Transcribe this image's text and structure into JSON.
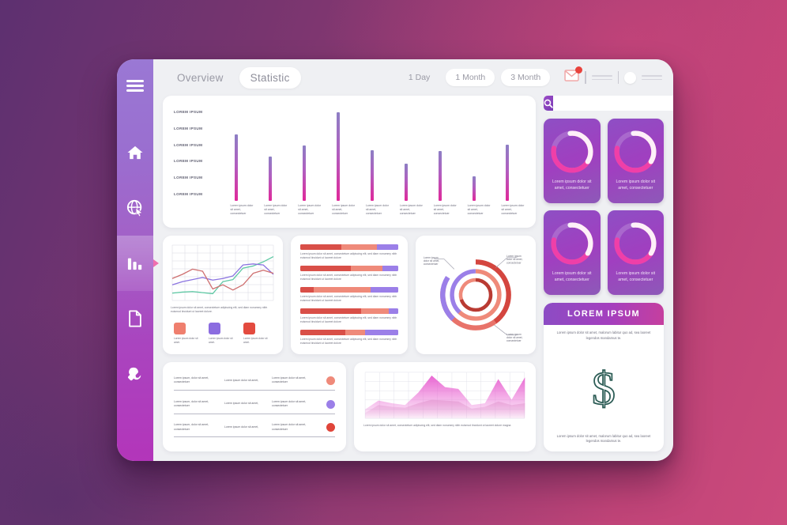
{
  "theme": {
    "bg_gradient_from": "#5d3070",
    "bg_gradient_to": "#cc4a7c",
    "sidebar_from": "#9a78d4",
    "sidebar_to": "#b335ba",
    "bar_top": "#8d7fc4",
    "bar_bottom": "#e0289a",
    "accent_red": "#d94f48",
    "accent_salmon": "#ef8a7a",
    "accent_purple": "#9b7fe8",
    "badge_red": "#e8423c",
    "dollar_teal": "#2d5d56"
  },
  "sidebar": {
    "menu_icon": "hamburger-icon",
    "items": [
      {
        "name": "home",
        "icon": "home-icon",
        "active": false
      },
      {
        "name": "globe",
        "icon": "globe-cursor-icon",
        "active": false
      },
      {
        "name": "statistics",
        "icon": "bar-chart-icon",
        "active": true
      },
      {
        "name": "documents",
        "icon": "document-icon",
        "active": false
      },
      {
        "name": "settings",
        "icon": "wrench-icon",
        "active": false
      }
    ]
  },
  "topbar": {
    "tabs": [
      {
        "label": "Overview",
        "active": false
      },
      {
        "label": "Statistic",
        "active": true
      }
    ],
    "ranges": [
      {
        "label": "1 Day",
        "boxed": false
      },
      {
        "label": "1 Month",
        "boxed": true
      },
      {
        "label": "3 Month",
        "boxed": true
      }
    ],
    "mail_icon": "mail-icon",
    "avatar_icon": "avatar-icon"
  },
  "search": {
    "icon": "search-icon",
    "value": "",
    "placeholder": ""
  },
  "chart_data": [
    {
      "id": "main-bar-chart",
      "type": "bar",
      "title": "",
      "xlabel": "",
      "ylabel": "",
      "y_tick_labels": [
        "LOREM IPSUM",
        "LOREM IPSUM",
        "LOREM IPSUM",
        "LOREM IPSUM",
        "LOREM IPSUM",
        "LOREM IPSUM"
      ],
      "categories": [
        "Lorem ipsum dolor sit amet, consectetuer",
        "Lorem ipsum dolor sit amet, consectetuer",
        "Lorem ipsum dolor sit amet, consectetuer",
        "Lorem ipsum dolor sit amet, consectetuer",
        "Lorem ipsum dolor sit amet, consectetuer",
        "Lorem ipsum dolor sit amet, consectetuer",
        "Lorem ipsum dolor sit amet, consectetuer",
        "Lorem ipsum dolor sit amet, consectetuer",
        "Lorem ipsum dolor sit amet, consectetuer"
      ],
      "values": [
        75,
        50,
        63,
        100,
        57,
        42,
        56,
        28,
        64
      ],
      "ylim": [
        0,
        100
      ],
      "grid": false
    },
    {
      "id": "multi-line-chart",
      "type": "line",
      "grid": true,
      "x": [
        0,
        1,
        2,
        3,
        4,
        5,
        6,
        7,
        8,
        9,
        10
      ],
      "series": [
        {
          "name": "Lorem ipsum dolor sit amet.",
          "color": "#5fc9a4",
          "values": [
            14,
            16,
            17,
            15,
            13,
            36,
            40,
            62,
            66,
            74,
            84
          ]
        },
        {
          "name": "Lorem ipsum dolor sit amet.",
          "color": "#8b74e0",
          "values": [
            30,
            36,
            40,
            44,
            39,
            42,
            47,
            68,
            70,
            68,
            50
          ]
        },
        {
          "name": "Lorem ipsum dolor sit amet.",
          "color": "#cf7070",
          "values": [
            42,
            50,
            60,
            56,
            22,
            30,
            20,
            30,
            52,
            58,
            52
          ]
        }
      ],
      "caption": "Lorem ipsum dolor sit amet, consectetuer adipiscing elit, sed diam nonummy nibh euismod tincidunt ut laoreet dolore.",
      "legend": [
        {
          "color": "#ef7f6e",
          "label": "Lorem ipsum dolor sit amet."
        },
        {
          "color": "#8b6ce0",
          "label": "Lorem ipsum dolor sit amet."
        },
        {
          "color": "#e34b3f",
          "label": "Lorem ipsum dolor sit amet."
        }
      ]
    },
    {
      "id": "stacked-hbar-list",
      "type": "bar",
      "orientation": "horizontal",
      "series_names": [
        "segment-1",
        "segment-2",
        "segment-3"
      ],
      "rows": [
        {
          "s1": 42,
          "s2": 36,
          "s3": 22,
          "caption": "Lorem ipsum dolor sit amet, consectetuer adipiscing elit, sed diam nonummy nibh euismod tincidunt ut laoreet dolore"
        },
        {
          "s1": 52,
          "s2": 32,
          "s3": 16,
          "caption": "Lorem ipsum dolor sit amet, consectetuer adipiscing elit, sed diam nonummy nibh euismod tincidunt ut laoreet dolore"
        },
        {
          "s1": 14,
          "s2": 58,
          "s3": 28,
          "caption": "Lorem ipsum dolor sit amet, consectetuer adipiscing elit, sed diam nonummy nibh euismod tincidunt ut laoreet dolore"
        },
        {
          "s1": 62,
          "s2": 28,
          "s3": 10,
          "caption": "Lorem ipsum dolor sit amet, consectetuer adipiscing elit, sed diam nonummy nibh euismod tincidunt ut laoreet dolore"
        },
        {
          "s1": 46,
          "s2": 20,
          "s3": 34,
          "caption": "Lorem ipsum dolor sit amet, consectetuer adipiscing elit, sed diam nonummy nibh euismod tincidunt ut laoreet dolore"
        }
      ]
    },
    {
      "id": "concentric-donut",
      "type": "pie",
      "variant": "concentric-rings",
      "rings": [
        {
          "name": "outer",
          "slices": [
            {
              "label": "Lorem ipsum dolor sit amet, consectetuer",
              "value": 40,
              "color": "#d4463f"
            },
            {
              "label": "Lorem ipsum dolor sit amet, consectetuer",
              "value": 38,
              "color": "#e8736a"
            },
            {
              "label": "Lorem ipsum dolor sit amet, consectetuer",
              "value": 22,
              "color": "#9b7fe8"
            }
          ]
        },
        {
          "name": "middle",
          "slices": [
            {
              "value": 62,
              "color": "#ef8a7a"
            },
            {
              "value": 38,
              "color": "#9b7fe8"
            }
          ]
        },
        {
          "name": "inner",
          "slices": [
            {
              "value": 70,
              "color": "#b93b33"
            },
            {
              "value": 30,
              "color": "#ef8a7a"
            }
          ]
        }
      ],
      "labels": [
        "Lorem ipsum dolor sit amet, consectetuer",
        "Lorem ipsum dolor sit amet, consectetuer",
        "Lorem ipsum dolor sit amet, consectetuer"
      ]
    },
    {
      "id": "pink-area-chart",
      "type": "area",
      "grid": true,
      "x": [
        0,
        1,
        2,
        3,
        4,
        5,
        6,
        7,
        8,
        9,
        10,
        11,
        12
      ],
      "series": [
        {
          "name": "series-a",
          "color": "#e85fd0",
          "values": [
            20,
            40,
            34,
            30,
            58,
            96,
            70,
            66,
            30,
            34,
            88,
            42,
            92
          ]
        },
        {
          "name": "series-b",
          "color": "#edb6dc",
          "values": [
            12,
            30,
            26,
            24,
            34,
            42,
            40,
            38,
            22,
            26,
            38,
            30,
            34
          ]
        }
      ],
      "caption": "Lorem ipsum dolor sit amet, consectetuer adipiscing elit, sed diam nonummy nibh euismod tincidunt ut laoreet dolore magna"
    }
  ],
  "table": {
    "rows": [
      {
        "c1": "Lorem ipsum, dolor sit amet, consectetuer",
        "c2": "Lorem ipsum dolor sit amet,",
        "c3": "Lorem ipsum dolor sit amet, consectetuer",
        "status_color": "#ef8a7a"
      },
      {
        "c1": "Lorem ipsum, dolor sit amet, consectetuer",
        "c2": "Lorem ipsum dolor sit amet,",
        "c3": "Lorem ipsum dolor sit amet, consectetuer",
        "status_color": "#9b7fe8"
      },
      {
        "c1": "Lorem ipsum, dolor sit amet, consectetuer",
        "c2": "Lorem ipsum dolor sit amet,",
        "c3": "Lorem ipsum dolor sit amet, consectetuer",
        "status_color": "#e0453a"
      }
    ]
  },
  "mini_cards": [
    {
      "caption": "Lorem ipsum dolor sit amet, consectetuer",
      "progress": 78
    },
    {
      "caption": "Lorem ipsum dolor sit amet, consectetuer",
      "progress": 78
    },
    {
      "caption": "Lorem ipsum dolor sit amet, consectetuer",
      "progress": 78
    },
    {
      "caption": "Lorem ipsum dolor sit amet, consectetuer",
      "progress": 78
    }
  ],
  "dollar_card": {
    "title": "LOREM IPSUM",
    "top_text": "Lorem ipsum dolor sit amet, malorum labitur quo ad, sea laoreet legendos mandamus te.",
    "glyph": "$",
    "bottom_text": "Lorem ipsum dolor sit amet, malorum labitur quo ad, sea laoreet legendos mandamus te."
  }
}
